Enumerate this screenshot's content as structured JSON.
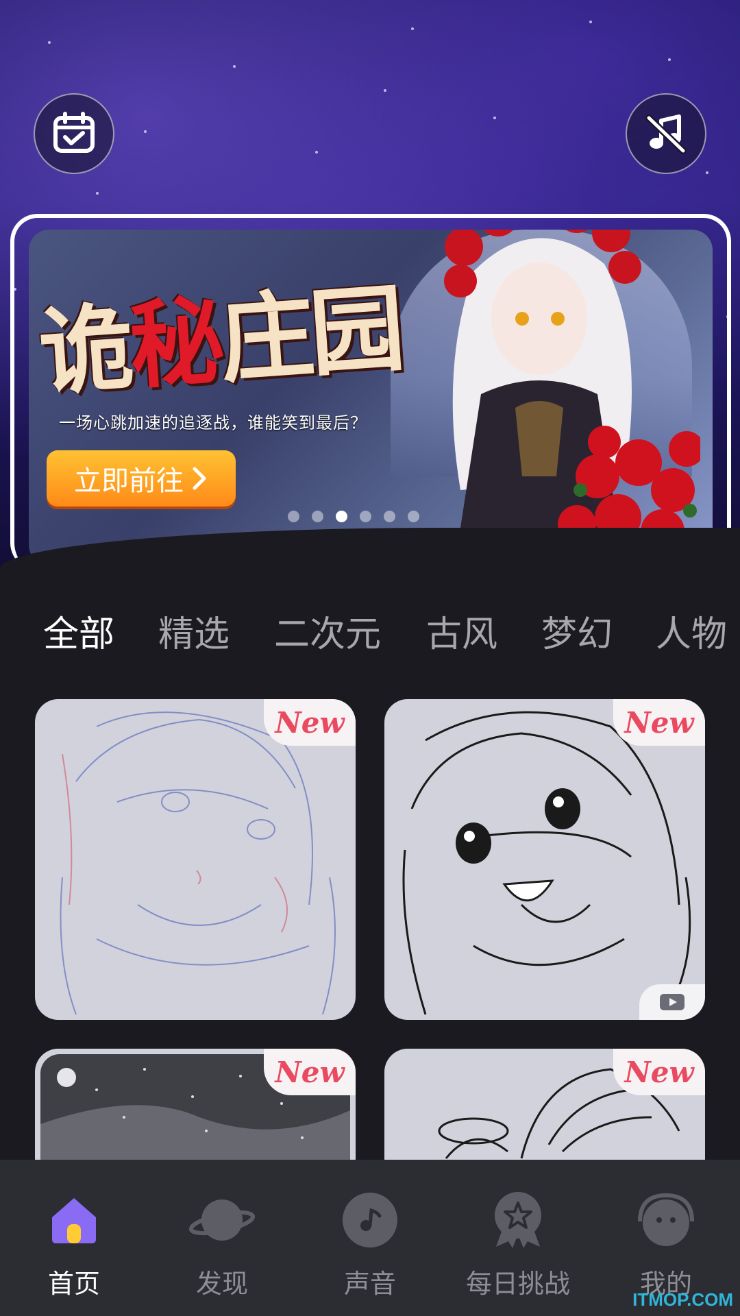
{
  "banner": {
    "title_part1": "诡",
    "title_part2": "秘",
    "title_part3": "庄园",
    "subtitle": "一场心跳加速的追逐战，谁能笑到最后？",
    "cta_label": "立即前往",
    "pagination": {
      "total": 6,
      "active_index": 2
    }
  },
  "categories": [
    "全部",
    "精选",
    "二次元",
    "古风",
    "梦幻",
    "人物"
  ],
  "active_category": "全部",
  "cards": [
    {
      "badge": "New",
      "video": false
    },
    {
      "badge": "New",
      "video": true
    },
    {
      "badge": "New",
      "video": false
    },
    {
      "badge": "New",
      "video": false
    }
  ],
  "nav": {
    "items": [
      {
        "label": "首页",
        "icon": "home-icon",
        "active": true
      },
      {
        "label": "发现",
        "icon": "planet-icon",
        "active": false
      },
      {
        "label": "声音",
        "icon": "music-note-icon",
        "active": false
      },
      {
        "label": "每日挑战",
        "icon": "star-badge-icon",
        "active": false
      },
      {
        "label": "我的",
        "icon": "profile-headphone-icon",
        "active": false
      }
    ]
  },
  "watermark": "ITMOP.COM",
  "colors": {
    "accent_purple": "#8a6cf4",
    "accent_yellow": "#ffcc33",
    "badge_red": "#ea4a60",
    "cta_orange": "#ff8a18",
    "nav_background": "#2c2c33",
    "page_background": "#1a1a20"
  }
}
